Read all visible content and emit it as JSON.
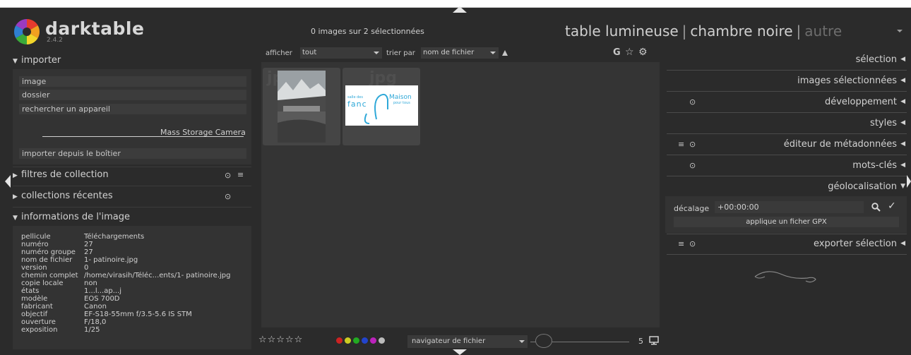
{
  "app": {
    "name": "darktable",
    "version": "2.4.2"
  },
  "header": {
    "selection_count": "0 images sur 2 sélectionnées",
    "views": {
      "lighttable": "table lumineuse",
      "darkroom": "chambre noire",
      "other": "autre",
      "separator": "|"
    }
  },
  "left_panel": {
    "import": {
      "title": "importer",
      "buttons": [
        "image",
        "dossier",
        "rechercher un appareil"
      ],
      "camera_label": "Mass Storage Camera",
      "import_from_camera": "importer depuis le boîtier"
    },
    "collection_filters": {
      "title": "filtres de collection"
    },
    "recent_collections": {
      "title": "collections récentes"
    },
    "image_info": {
      "title": "informations de l'image",
      "rows": [
        {
          "label": "pellicule",
          "value": "Téléchargements"
        },
        {
          "label": "numéro",
          "value": "27"
        },
        {
          "label": "numéro groupe",
          "value": "27"
        },
        {
          "label": "nom de fichier",
          "value": "1- patinoire.jpg"
        },
        {
          "label": "version",
          "value": "0"
        },
        {
          "label": "chemin complet",
          "value": "/home/virasih/Téléc...ents/1- patinoire.jpg"
        },
        {
          "label": "copie locale",
          "value": "non"
        },
        {
          "label": "états",
          "value": "1...l...ap...j"
        },
        {
          "label": "modèle",
          "value": "EOS 700D"
        },
        {
          "label": "fabricant",
          "value": "Canon"
        },
        {
          "label": "objectif",
          "value": "EF-S18-55mm f/3.5-5.6 IS STM"
        },
        {
          "label": "ouverture",
          "value": "F/18,0"
        },
        {
          "label": "exposition",
          "value": "1/25"
        }
      ]
    }
  },
  "center": {
    "toolbar": {
      "show_label": "afficher",
      "show_value": "tout",
      "sort_label": "trier par",
      "sort_value": "nom de fichier",
      "grouping_letter": "G"
    },
    "thumbnails": [
      {
        "ext": "jpg",
        "name": "1- patinoire.jpg"
      },
      {
        "ext": "jpg",
        "logo_word_1": "salle des",
        "logo_word_2": "fanc",
        "logo_word_3": "Maison",
        "logo_word_4": "pour tous"
      }
    ],
    "bottom_bar": {
      "color_labels": [
        "#cc2222",
        "#cccc22",
        "#22aa22",
        "#2244cc",
        "#bb22bb",
        "#bbbbbb"
      ],
      "navigator_value": "navigateur de fichier",
      "zoom_value": "5",
      "star_count": 5
    }
  },
  "right_panel": {
    "modules": [
      "sélection",
      "images sélectionnées",
      "développement",
      "styles",
      "éditeur de métadonnées",
      "mots-clés",
      "géolocalisation",
      "exporter sélection"
    ],
    "geolocation": {
      "offset_label": "décalage",
      "offset_value": "+00:00:00",
      "apply_gpx": "applique un ficher GPX"
    }
  },
  "colors": {
    "background": "#2b2b2b",
    "panel": "#333333",
    "lighttable": "#343434",
    "text": "#c8c8c8",
    "accent_blue": "#2ea8d8"
  }
}
